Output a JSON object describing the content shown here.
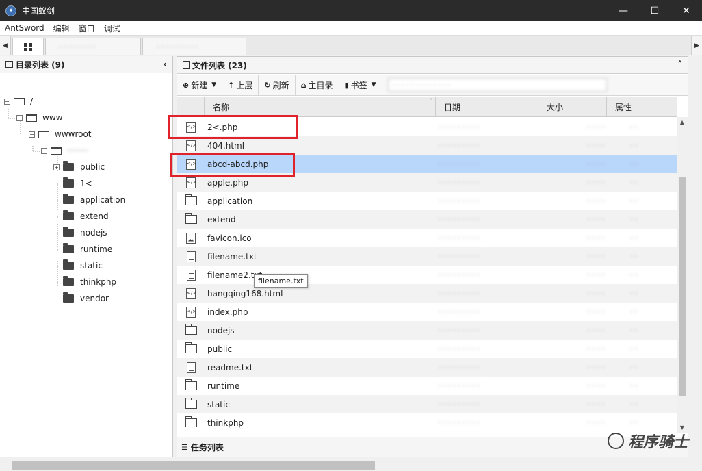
{
  "window": {
    "title": "中国蚁剑",
    "controls": [
      "—",
      "☐",
      "✕"
    ]
  },
  "menu": [
    "AntSword",
    "编辑",
    "窗口",
    "调试"
  ],
  "tabs": {
    "left_arrow": "◀",
    "right_arrow": "▶",
    "home_icon": "grid-icon",
    "tab1": "· · · · · · · ·",
    "tab2": "· · · · · · · · ·"
  },
  "left_panel": {
    "title": "目录列表 (9)",
    "collapse": "‹",
    "tree": [
      {
        "label": "/",
        "level": 0,
        "expander": "−",
        "type": "open"
      },
      {
        "label": "www",
        "level": 1,
        "expander": "−",
        "type": "open"
      },
      {
        "label": "wwwroot",
        "level": 2,
        "expander": "−",
        "type": "open"
      },
      {
        "label": "········",
        "level": 3,
        "expander": "−",
        "type": "open",
        "blur": true
      },
      {
        "label": "public",
        "level": 4,
        "expander": "+",
        "type": "closed"
      },
      {
        "label": "1<",
        "level": 4,
        "expander": "",
        "type": "closed"
      },
      {
        "label": "application",
        "level": 4,
        "expander": "",
        "type": "closed"
      },
      {
        "label": "extend",
        "level": 4,
        "expander": "",
        "type": "closed"
      },
      {
        "label": "nodejs",
        "level": 4,
        "expander": "",
        "type": "closed"
      },
      {
        "label": "runtime",
        "level": 4,
        "expander": "",
        "type": "closed"
      },
      {
        "label": "static",
        "level": 4,
        "expander": "",
        "type": "closed"
      },
      {
        "label": "thinkphp",
        "level": 4,
        "expander": "",
        "type": "closed"
      },
      {
        "label": "vendor",
        "level": 4,
        "expander": "",
        "type": "closed"
      }
    ]
  },
  "right_panel": {
    "title": "文件列表 (23)",
    "collapse": "˄",
    "toolbar": {
      "new_label": "新建",
      "up_label": "上层",
      "refresh_label": "刷新",
      "home_label": "主目录",
      "bookmark_label": "书签",
      "path_value": "· · · · · · · · · · · · ·"
    },
    "columns": [
      "名称",
      "日期",
      "大小",
      "属性"
    ],
    "files": [
      {
        "name": "2<.php",
        "icon": "code"
      },
      {
        "name": "404.html",
        "icon": "code"
      },
      {
        "name": "abcd-abcd.php",
        "icon": "code",
        "selected": true
      },
      {
        "name": "apple.php",
        "icon": "code"
      },
      {
        "name": "application",
        "icon": "folder"
      },
      {
        "name": "extend",
        "icon": "folder"
      },
      {
        "name": "favicon.ico",
        "icon": "image"
      },
      {
        "name": "filename.txt",
        "icon": "text"
      },
      {
        "name": "filename2.txt",
        "icon": "text"
      },
      {
        "name": "hangqing168.html",
        "icon": "code"
      },
      {
        "name": "index.php",
        "icon": "code"
      },
      {
        "name": "nodejs",
        "icon": "folder"
      },
      {
        "name": "public",
        "icon": "folder"
      },
      {
        "name": "readme.txt",
        "icon": "text"
      },
      {
        "name": "runtime",
        "icon": "folder"
      },
      {
        "name": "static",
        "icon": "folder"
      },
      {
        "name": "thinkphp",
        "icon": "folder"
      }
    ],
    "blurred_date": "· · · · · · · · ·",
    "blurred_size": "· · · ·",
    "blurred_attr": "· ·",
    "tooltip": "filename.txt",
    "task_title": "任务列表"
  },
  "watermark": "程序骑士",
  "colors": {
    "titlebar": "#2b2b2b",
    "selected_row": "#b9d7fb",
    "highlight": "#e0232b"
  }
}
